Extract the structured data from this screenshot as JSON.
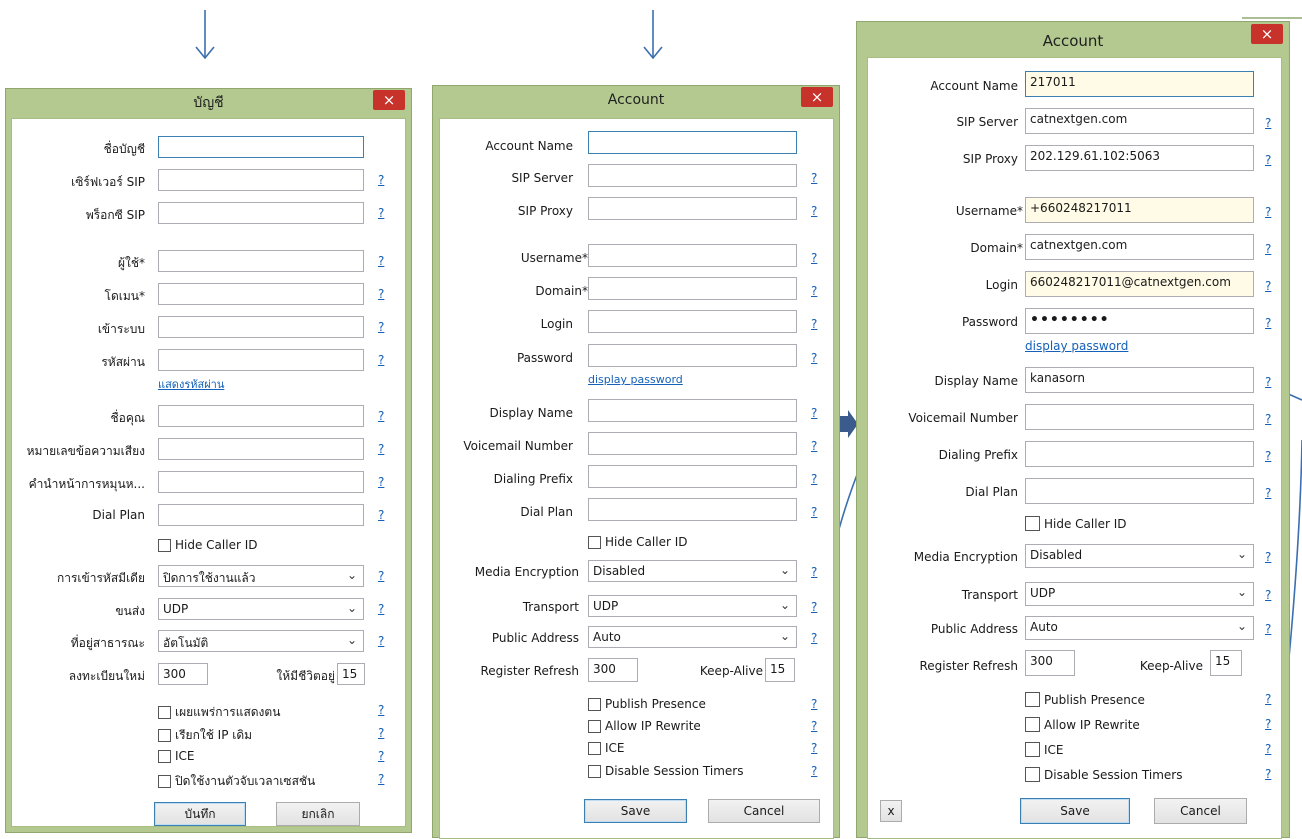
{
  "dialog_th": {
    "title": "บัญชี",
    "close": "×",
    "labels": {
      "account_name": "ชื่อบัญชี",
      "sip_server": "เซิร์ฟเวอร์ SIP",
      "sip_proxy": "พร็อกซี SIP",
      "username": "ผู้ใช้*",
      "domain": "โดเมน*",
      "login": "เข้าระบบ",
      "password": "รหัสผ่าน",
      "display_name": "ชื่อคุณ",
      "voicemail": "หมายเลขข้อความเสียง",
      "dialing_prefix": "คำนำหน้าการหมุนห...",
      "dial_plan": "Dial Plan",
      "media_encryption": "การเข้ารหัสมีเดีย",
      "transport": "ขนส่ง",
      "public_address": "ที่อยู่สาธารณะ",
      "register_refresh": "ลงทะเบียนใหม่",
      "keep_alive": "ให้มีชีวิตอยู่"
    },
    "display_password": "แสดงรหัสผ่าน",
    "hide_caller_id": "Hide Caller ID",
    "media_encryption_value": "ปิดการใช้งานแล้ว",
    "transport_value": "UDP",
    "public_address_value": "อัตโนมัติ",
    "register_refresh_value": "300",
    "keep_alive_value": "15",
    "checkboxes": [
      "เผยแพร่การแสดงตน",
      "เรียกใช้ IP เดิม",
      "ICE",
      "ปิดใช้งานตัวจับเวลาเซสชัน"
    ],
    "save": "บันทึก",
    "cancel": "ยกเลิก"
  },
  "dialog_en_empty": {
    "title": "Account",
    "close": "×",
    "labels": {
      "account_name": "Account Name",
      "sip_server": "SIP Server",
      "sip_proxy": "SIP Proxy",
      "username": "Username*",
      "domain": "Domain*",
      "login": "Login",
      "password": "Password",
      "display_name": "Display Name",
      "voicemail": "Voicemail Number",
      "dialing_prefix": "Dialing Prefix",
      "dial_plan": "Dial Plan",
      "media_encryption": "Media Encryption",
      "transport": "Transport",
      "public_address": "Public Address",
      "register_refresh": "Register Refresh",
      "keep_alive": "Keep-Alive"
    },
    "display_password": "display password",
    "hide_caller_id": "Hide Caller ID",
    "media_encryption_value": "Disabled",
    "transport_value": "UDP",
    "public_address_value": "Auto",
    "register_refresh_value": "300",
    "keep_alive_value": "15",
    "checkboxes": [
      "Publish Presence",
      "Allow IP Rewrite",
      "ICE",
      "Disable Session Timers"
    ],
    "save": "Save",
    "cancel": "Cancel"
  },
  "dialog_en_filled": {
    "title": "Account",
    "close": "×",
    "labels": {
      "account_name": "Account Name",
      "sip_server": "SIP Server",
      "sip_proxy": "SIP Proxy",
      "username": "Username*",
      "domain": "Domain*",
      "login": "Login",
      "password": "Password",
      "display_name": "Display Name",
      "voicemail": "Voicemail Number",
      "dialing_prefix": "Dialing Prefix",
      "dial_plan": "Dial Plan",
      "media_encryption": "Media Encryption",
      "transport": "Transport",
      "public_address": "Public Address",
      "register_refresh": "Register Refresh",
      "keep_alive": "Keep-Alive"
    },
    "values": {
      "account_name": "217011",
      "sip_server": "catnextgen.com",
      "sip_proxy": "202.129.61.102:5063",
      "username": "+660248217011",
      "domain": "catnextgen.com",
      "login": "660248217011@catnextgen.com",
      "password": "••••••••",
      "display_name": "kanasorn"
    },
    "display_password": "display password",
    "hide_caller_id": "Hide Caller ID",
    "media_encryption_value": "Disabled",
    "transport_value": "UDP",
    "public_address_value": "Auto",
    "register_refresh_value": "300",
    "keep_alive_value": "15",
    "checkboxes": [
      "Publish Presence",
      "Allow IP Rewrite",
      "ICE",
      "Disable Session Timers"
    ],
    "save": "Save",
    "cancel": "Cancel",
    "x_button": "x"
  },
  "help_mark": "?",
  "chevron": "⌄",
  "icons": {
    "down_arrow": "down-arrow-icon",
    "right_arrow": "right-arrow-icon",
    "annotation_curve": "annotation-curve"
  },
  "colors": {
    "frame": "#b3c98f",
    "close": "#c7322a",
    "link": "#1560b8",
    "annotation": "#3c6fb0"
  }
}
